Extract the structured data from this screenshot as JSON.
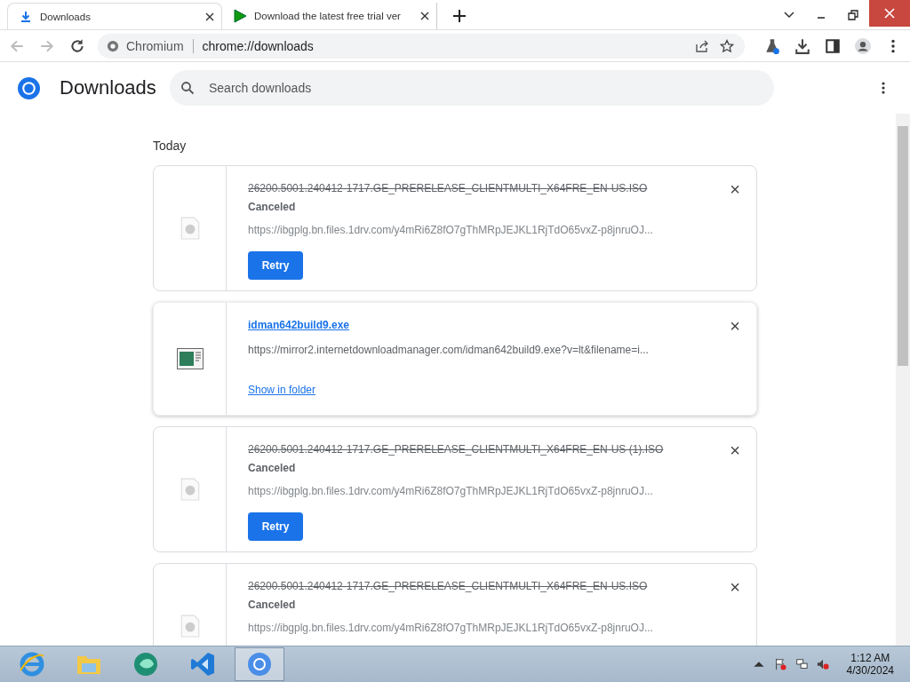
{
  "tabs": [
    {
      "title": "Downloads",
      "selected": true
    },
    {
      "title": "Download the latest free trial ver",
      "selected": false
    }
  ],
  "address": {
    "site": "Chromium",
    "url": "chrome://downloads"
  },
  "header": {
    "title": "Downloads",
    "search": {
      "placeholder": "Search downloads"
    }
  },
  "section": "Today",
  "downloads": [
    {
      "kind": "canceled",
      "name": "26200.5001.240412-1717.GE_PRERELEASE_CLIENTMULTI_X64FRE_EN-US.ISO",
      "status": "Canceled",
      "url": "https://ibgplg.bn.files.1drv.com/y4mRi6Z8fO7gThMRpJEJKL1RjTdO65vxZ-p8jnruOJ...",
      "button": "Retry",
      "close": "×"
    },
    {
      "kind": "complete",
      "name": "idman642build9.exe",
      "url": "https://mirror2.internetdownloadmanager.com/idman642build9.exe?v=lt&filename=i...",
      "link": "Show in folder",
      "close": "×"
    },
    {
      "kind": "canceled",
      "name": "26200.5001.240412-1717.GE_PRERELEASE_CLIENTMULTI_X64FRE_EN-US (1).ISO",
      "status": "Canceled",
      "url": "https://ibgplg.bn.files.1drv.com/y4mRi6Z8fO7gThMRpJEJKL1RjTdO65vxZ-p8jnruOJ...",
      "button": "Retry",
      "close": "×"
    },
    {
      "kind": "canceled",
      "name": "26200.5001.240412-1717.GE_PRERELEASE_CLIENTMULTI_X64FRE_EN-US.ISO",
      "status": "Canceled",
      "url": "https://ibgplg.bn.files.1drv.com/y4mRi6Z8fO7gThMRpJEJKL1RjTdO65vxZ-p8jnruOJ...",
      "close": "×"
    }
  ],
  "taskbar": {
    "apps": [
      {
        "selected": false
      },
      {
        "selected": false
      },
      {
        "selected": false
      },
      {
        "selected": false
      },
      {
        "selected": true
      }
    ],
    "time": "1:12 AM",
    "date": "4/30/2024"
  }
}
